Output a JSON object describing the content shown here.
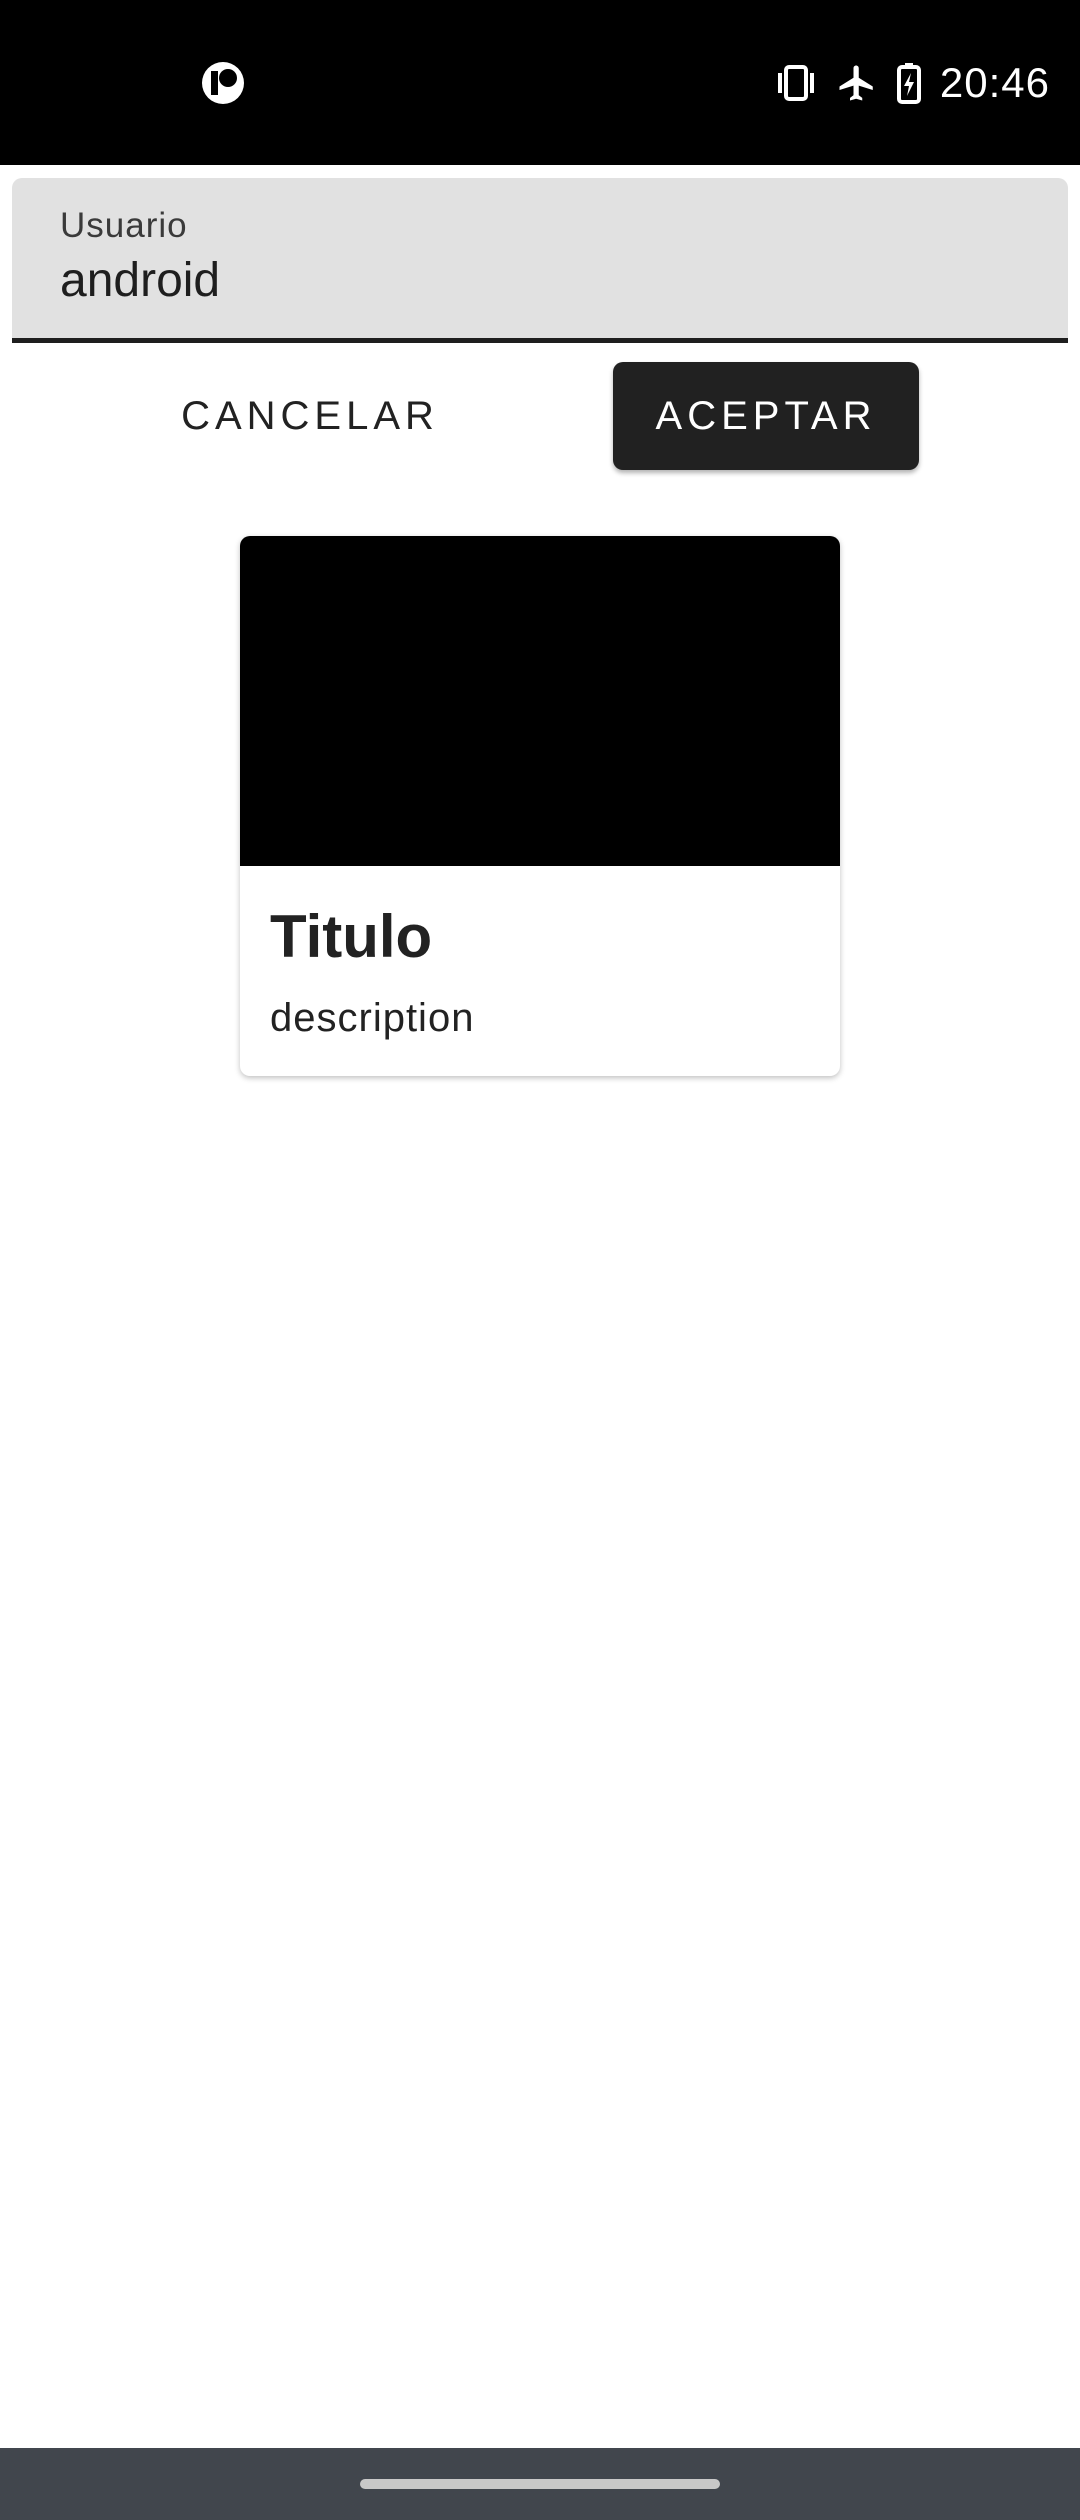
{
  "status_bar": {
    "time": "20:46",
    "app_icon": "notification-app-icon",
    "icons": [
      "vibrate-icon",
      "airplane-mode-icon",
      "battery-charging-icon"
    ]
  },
  "form": {
    "field_label": "Usuario",
    "field_value": "android"
  },
  "buttons": {
    "cancel_label": "CANCELAR",
    "accept_label": "ACEPTAR"
  },
  "card": {
    "title": "Titulo",
    "description": "description"
  },
  "colors": {
    "status_bar": "#000000",
    "field_background": "#e1e1e1",
    "accept_button": "#212121",
    "nav_bar": "#41464d"
  }
}
